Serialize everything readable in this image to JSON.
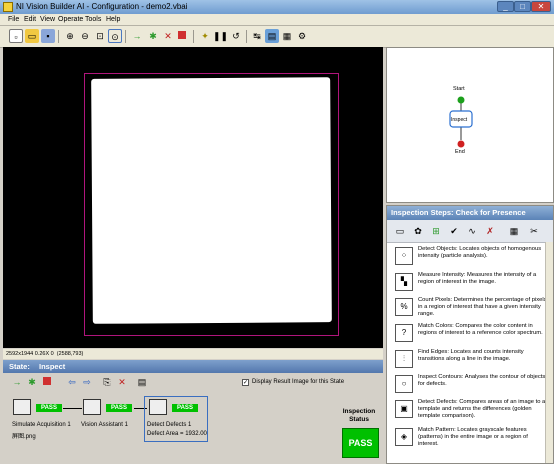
{
  "window": {
    "title": "NI Vision Builder AI - Configuration - demo2.vbai",
    "minimize": "_",
    "maximize": "□",
    "close": "✕"
  },
  "menu": [
    "File",
    "Edit",
    "View",
    "Operate",
    "Tools",
    "Help"
  ],
  "toolbar": {
    "icons": [
      "new-icon",
      "open-icon",
      "save-icon",
      "zoom-in-icon",
      "zoom-out-icon",
      "zoom-fit-icon",
      "zoom-1to1-icon",
      "next-step-icon",
      "run-icon",
      "stop-run-icon",
      "stop-icon",
      "lightbulb-icon",
      "pause-icon",
      "loop-icon",
      "link-icon",
      "image-icon",
      "snapshot-icon",
      "settings-icon"
    ]
  },
  "image_status": "2592x1944 0.26X 0  (2588,793)",
  "flowchart": {
    "start": "Start",
    "inspect": "Inspect",
    "end": "End"
  },
  "steps_panel": {
    "title": "Inspection Steps: Check for Presence",
    "category_icons": [
      "measure-icon",
      "color-icon",
      "multi-icon",
      "check-icon",
      "graph-icon",
      "tools-icon"
    ],
    "items": [
      {
        "icon": "detect-objects-icon",
        "text": "Detect Objects:  Locates objects of homogenous intensity (particle analysis)."
      },
      {
        "icon": "measure-intensity-icon",
        "text": "Measure Intensity:  Measures the intensity of a region of interest in the image."
      },
      {
        "icon": "count-pixels-icon",
        "text": "Count Pixels:  Determines the percentage of pixels in a region of interest that have a given intensity range."
      },
      {
        "icon": "match-colors-icon",
        "text": "Match Colors:  Compares the color content in regions of interest to a reference color spectrum."
      },
      {
        "icon": "find-edges-icon",
        "text": "Find Edges:  Locates and counts intensity transitions along a line in the image."
      },
      {
        "icon": "inspect-contours-icon",
        "text": "Inspect Contours:  Analyses the contour of objects for defects."
      },
      {
        "icon": "detect-defects-icon",
        "text": "Detect Defects:  Compares areas of an image to a template and returns the differences (golden template comparison)."
      },
      {
        "icon": "match-pattern-icon",
        "text": "Match Pattern:  Locates grayscale features (patterns) in the entire image or a region of interest."
      }
    ]
  },
  "state": {
    "label": "State:",
    "name": "Inspect",
    "display_checkbox_label": "Display Result Image for this State",
    "display_checked": true,
    "steps": [
      {
        "name": "Simulate Acquisition 1",
        "status": "PASS",
        "extra": "屏图.png"
      },
      {
        "name": "Vision Assistant 1",
        "status": "PASS",
        "extra": ""
      },
      {
        "name": "Detect Defects 1",
        "status": "PASS",
        "extra": "Defect Area = 1932.00"
      }
    ]
  },
  "inspection_status": {
    "label": "Inspection Status",
    "value": "PASS"
  },
  "colors": {
    "pass_green": "#00c000",
    "roi_magenta": "#b0157c",
    "title_blue": "#6f9cd0"
  }
}
